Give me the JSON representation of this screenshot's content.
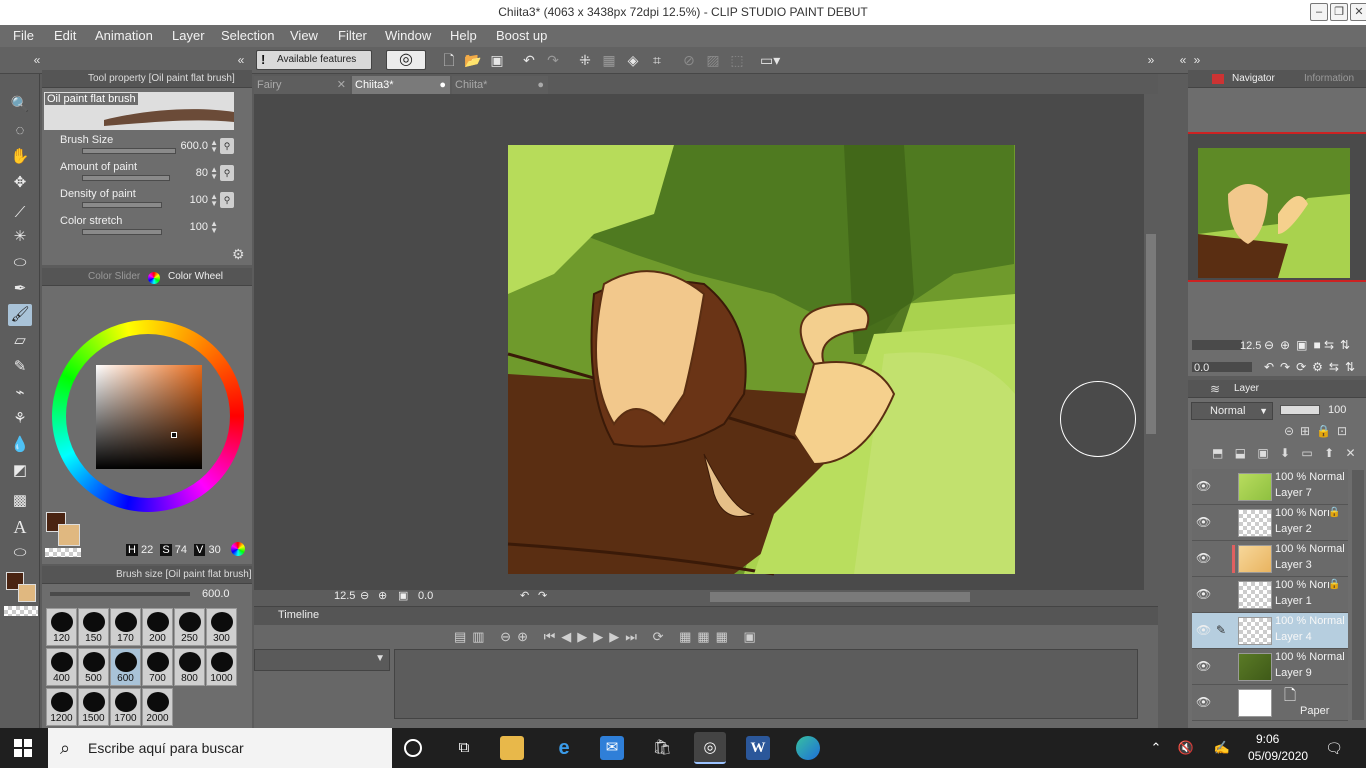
{
  "titlebar": {
    "title": "Chiita3* (4063 x 3438px 72dpi 12.5%)  - CLIP STUDIO PAINT DEBUT"
  },
  "menu": [
    "File",
    "Edit",
    "Animation",
    "Layer",
    "Selection",
    "View",
    "Filter",
    "Window",
    "Help",
    "Boost up"
  ],
  "command_bar": {
    "available_features": "Available features"
  },
  "tool_property": {
    "header": "Tool property [Oil paint flat brush]",
    "brush_name": "Oil paint flat brush",
    "params": [
      {
        "label": "Brush Size",
        "value": "600.0"
      },
      {
        "label": "Amount of paint",
        "value": "80"
      },
      {
        "label": "Density of paint",
        "value": "100"
      },
      {
        "label": "Color stretch",
        "value": "100"
      }
    ]
  },
  "color_panel": {
    "tab_slider": "Color Slider",
    "tab_wheel": "Color Wheel",
    "h_label": "H",
    "h_value": "22",
    "s_label": "S",
    "s_value": "74",
    "v_label": "V",
    "v_value": "30",
    "main_color": "#4a2412",
    "sub_color": "#e0b880"
  },
  "brush_size_panel": {
    "header": "Brush size [Oil paint flat brush]",
    "current": "600.0",
    "sizes": [
      "120",
      "150",
      "170",
      "200",
      "250",
      "300",
      "400",
      "500",
      "600",
      "700",
      "800",
      "1000",
      "1200",
      "1500",
      "1700",
      "2000"
    ]
  },
  "doc_tabs": [
    "Fairy",
    "Chiita3*",
    "Chiita*"
  ],
  "canvas_status": {
    "zoom": "12.5",
    "angle": "0.0"
  },
  "timeline": {
    "tab": "Timeline"
  },
  "navigator": {
    "tab": "Navigator",
    "tab_info": "Information",
    "zoom": "12.5",
    "angle": "0.0"
  },
  "layer_panel": {
    "tab": "Layer",
    "blend_mode": "Normal",
    "opacity": "100",
    "layers": [
      {
        "opacity_mode": "100 % Normal",
        "name": "Layer 7"
      },
      {
        "opacity_mode": "100 % Norı",
        "name": "Layer 2"
      },
      {
        "opacity_mode": "100 % Normal",
        "name": "Layer 3"
      },
      {
        "opacity_mode": "100 % Norı",
        "name": "Layer 1"
      },
      {
        "opacity_mode": "100 % Normal",
        "name": "Layer 4"
      },
      {
        "opacity_mode": "100 % Normal",
        "name": "Layer 9"
      },
      {
        "opacity_mode": "",
        "name": "Paper"
      }
    ]
  },
  "taskbar": {
    "search_placeholder": "Escribe aquí para buscar",
    "time": "9:06",
    "date": "05/09/2020"
  }
}
